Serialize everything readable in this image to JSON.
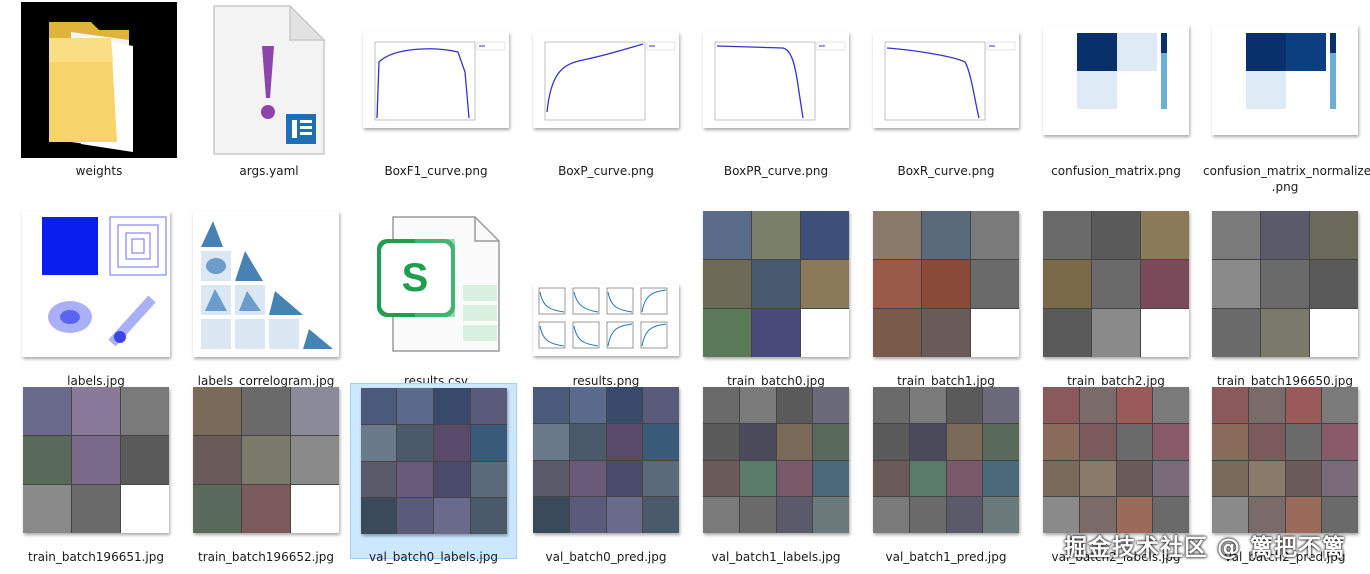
{
  "files": [
    {
      "name": "weights",
      "kind": "folder"
    },
    {
      "name": "args.yaml",
      "kind": "yaml"
    },
    {
      "name": "BoxF1_curve.png",
      "kind": "curve"
    },
    {
      "name": "BoxP_curve.png",
      "kind": "curve"
    },
    {
      "name": "BoxPR_curve.png",
      "kind": "curve"
    },
    {
      "name": "BoxR_curve.png",
      "kind": "curve"
    },
    {
      "name": "confusion_matrix.png",
      "kind": "matrix"
    },
    {
      "name": "confusion_matrix_normalized .png",
      "kind": "matrix"
    },
    {
      "name": "labels.jpg",
      "kind": "labels"
    },
    {
      "name": "labels_correlogram.jpg",
      "kind": "correlogram"
    },
    {
      "name": "results.csv",
      "kind": "csv"
    },
    {
      "name": "results.png",
      "kind": "results"
    },
    {
      "name": "train_batch0.jpg",
      "kind": "batch"
    },
    {
      "name": "train_batch1.jpg",
      "kind": "batch"
    },
    {
      "name": "train_batch2.jpg",
      "kind": "batch"
    },
    {
      "name": "train_batch196650.jpg",
      "kind": "batch"
    },
    {
      "name": "train_batch196651.jpg",
      "kind": "batch"
    },
    {
      "name": "train_batch196652.jpg",
      "kind": "batch"
    },
    {
      "name": "val_batch0_labels.jpg",
      "kind": "val",
      "selected": true
    },
    {
      "name": "val_batch0_pred.jpg",
      "kind": "val"
    },
    {
      "name": "val_batch1_labels.jpg",
      "kind": "val"
    },
    {
      "name": "val_batch1_pred.jpg",
      "kind": "val"
    },
    {
      "name": "val_batch2_labels.jpg",
      "kind": "val"
    },
    {
      "name": "val_batch2_pred.jpg",
      "kind": "val"
    }
  ],
  "watermark": "掘金技术社区 @ 篱把不篱",
  "colors": {
    "selection": "#cce8ff",
    "curve": "#3333cc",
    "matrix_dark": "#08306b",
    "matrix_light": "#deebf7",
    "csv_green": "#1e9e4f",
    "yaml_purple": "#8e44ad",
    "labels_blue": "#0a1ef0",
    "folder_yellow": "#f2c84b"
  }
}
